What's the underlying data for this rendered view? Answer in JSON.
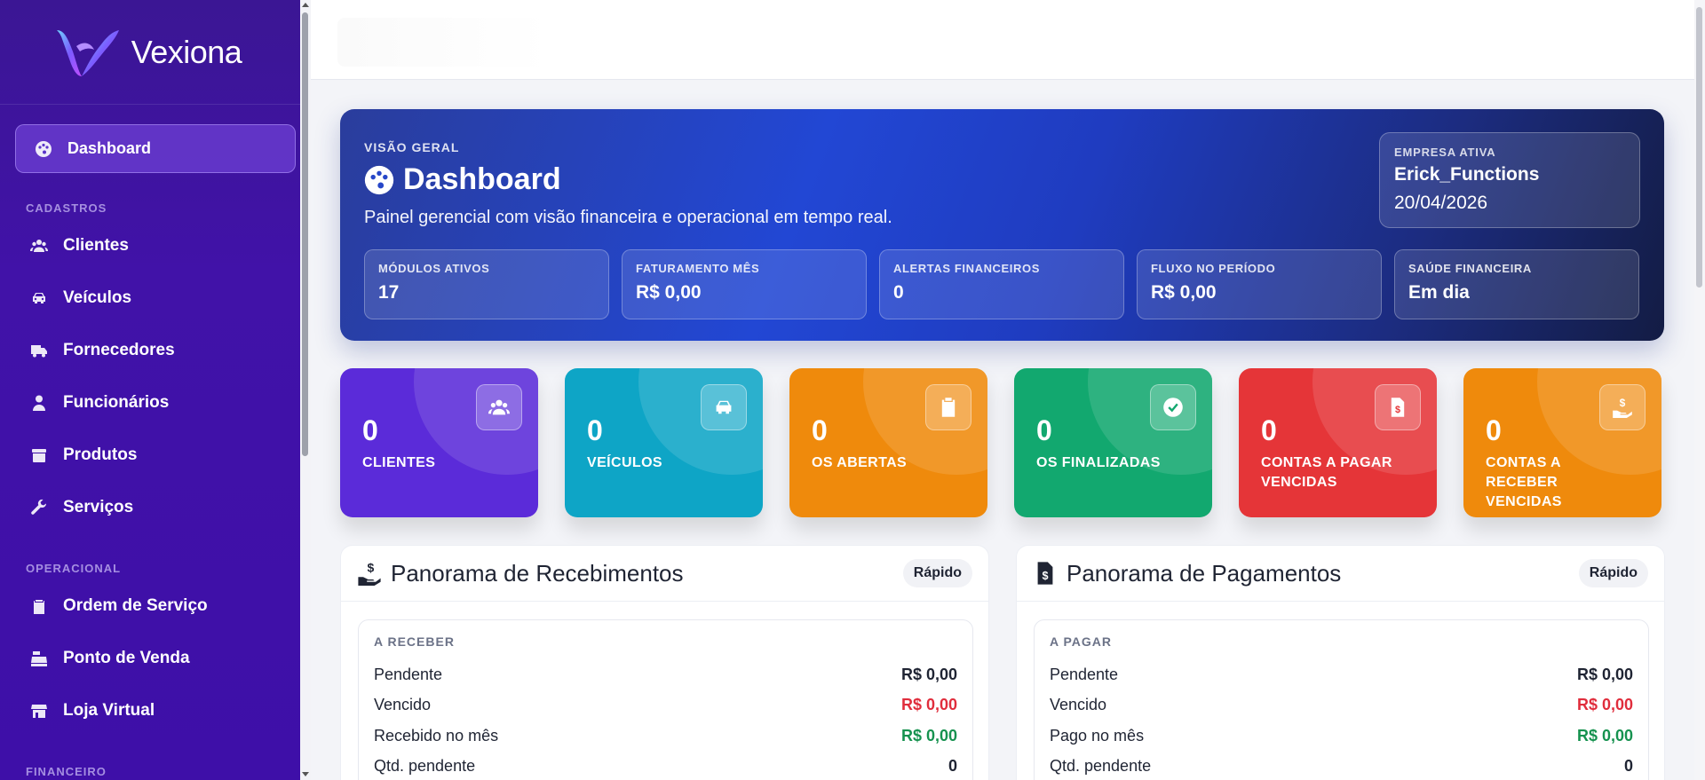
{
  "brand": {
    "name": "Vexiona"
  },
  "sidebar": {
    "active": {
      "label": "Dashboard"
    },
    "sections": [
      {
        "title": "CADASTROS",
        "items": [
          {
            "label": "Clientes",
            "icon": "users-icon"
          },
          {
            "label": "Veículos",
            "icon": "car-icon"
          },
          {
            "label": "Fornecedores",
            "icon": "truck-icon"
          },
          {
            "label": "Funcionários",
            "icon": "user-tie-icon"
          },
          {
            "label": "Produtos",
            "icon": "box-icon"
          },
          {
            "label": "Serviços",
            "icon": "wrench-icon"
          }
        ]
      },
      {
        "title": "OPERACIONAL",
        "items": [
          {
            "label": "Ordem de Serviço",
            "icon": "clipboard-icon"
          },
          {
            "label": "Ponto de Venda",
            "icon": "cash-register-icon"
          },
          {
            "label": "Loja Virtual",
            "icon": "store-icon"
          }
        ]
      },
      {
        "title": "FINANCEIRO",
        "items": []
      }
    ]
  },
  "hero": {
    "kicker": "VISÃO GERAL",
    "title": "Dashboard",
    "subtitle": "Painel gerencial com visão financeira e operacional em tempo real.",
    "company": {
      "label": "EMPRESA ATIVA",
      "name": "Erick_Functions",
      "date": "20/04/2026"
    },
    "kpis": [
      {
        "label": "MÓDULOS ATIVOS",
        "value": "17"
      },
      {
        "label": "FATURAMENTO MÊS",
        "value": "R$ 0,00"
      },
      {
        "label": "ALERTAS FINANCEIROS",
        "value": "0"
      },
      {
        "label": "FLUXO NO PERÍODO",
        "value": "R$ 0,00"
      },
      {
        "label": "SAÚDE FINANCEIRA",
        "value": "Em dia"
      }
    ]
  },
  "stats": [
    {
      "value": "0",
      "label": "CLIENTES",
      "color": "#5b2bd9",
      "icon": "users-icon"
    },
    {
      "value": "0",
      "label": "VEÍCULOS",
      "color": "#0ea5c6",
      "icon": "car-icon"
    },
    {
      "value": "0",
      "label": "OS ABERTAS",
      "color": "#ef8a0c",
      "icon": "clipboard-icon"
    },
    {
      "value": "0",
      "label": "OS FINALIZADAS",
      "color": "#12a86f",
      "icon": "check-circle-icon"
    },
    {
      "value": "0",
      "label": "CONTAS A PAGAR VENCIDAS",
      "color": "#e53538",
      "icon": "invoice-dollar-icon"
    },
    {
      "value": "0",
      "label": "CONTAS A RECEBER VENCIDAS",
      "color": "#ef8a0c",
      "icon": "hand-dollar-icon"
    }
  ],
  "receb": {
    "title": "Panorama de Recebimentos",
    "badge": "Rápido",
    "box_label": "A RECEBER",
    "rows": [
      {
        "label": "Pendente",
        "value": "R$ 0,00"
      },
      {
        "label": "Vencido",
        "value": "R$ 0,00"
      },
      {
        "label": "Recebido no mês",
        "value": "R$ 0,00"
      },
      {
        "label": "Qtd. pendente",
        "value": "0"
      }
    ]
  },
  "pag": {
    "title": "Panorama de Pagamentos",
    "badge": "Rápido",
    "box_label": "A PAGAR",
    "rows": [
      {
        "label": "Pendente",
        "value": "R$ 0,00"
      },
      {
        "label": "Vencido",
        "value": "R$ 0,00"
      },
      {
        "label": "Pago no mês",
        "value": "R$ 0,00"
      },
      {
        "label": "Qtd. pendente",
        "value": "0"
      }
    ]
  }
}
